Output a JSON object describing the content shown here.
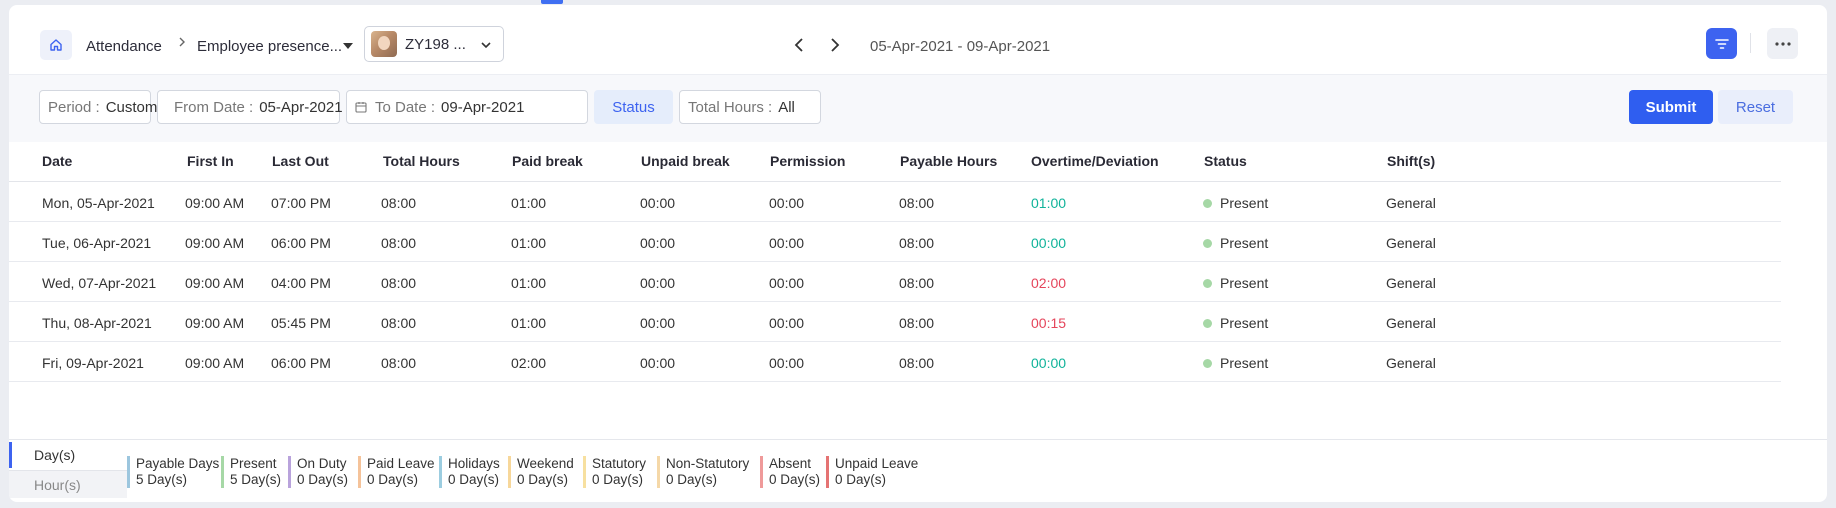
{
  "breadcrumb": {
    "module": "Attendance",
    "page": "Employee presence..."
  },
  "employee": {
    "code": "ZY198 ..."
  },
  "date_range": "05-Apr-2021 - 09-Apr-2021",
  "filters": {
    "period_label": "Period :",
    "period_value": "Custom",
    "from_label": "From Date :",
    "from_value": "05-Apr-2021",
    "to_label": "To Date :",
    "to_value": "09-Apr-2021",
    "status_label": "Status",
    "total_hours_label": "Total Hours :",
    "total_hours_value": "All",
    "submit_label": "Submit",
    "reset_label": "Reset"
  },
  "table": {
    "headers": [
      "Date",
      "First In",
      "Last Out",
      "Total Hours",
      "Paid break",
      "Unpaid break",
      "Permission",
      "Payable Hours",
      "Overtime/Deviation",
      "Status",
      "Shift(s)"
    ],
    "rows": [
      {
        "date": "Mon, 05-Apr-2021",
        "first_in": "09:00 AM",
        "last_out": "07:00 PM",
        "total": "08:00",
        "paid": "01:00",
        "unpaid": "00:00",
        "permission": "00:00",
        "payable": "08:00",
        "overtime": "01:00",
        "overtime_color": "#10b39a",
        "status": "Present",
        "shift": "General"
      },
      {
        "date": "Tue, 06-Apr-2021",
        "first_in": "09:00 AM",
        "last_out": "06:00 PM",
        "total": "08:00",
        "paid": "01:00",
        "unpaid": "00:00",
        "permission": "00:00",
        "payable": "08:00",
        "overtime": "00:00",
        "overtime_color": "#10b39a",
        "status": "Present",
        "shift": "General"
      },
      {
        "date": "Wed, 07-Apr-2021",
        "first_in": "09:00 AM",
        "last_out": "04:00 PM",
        "total": "08:00",
        "paid": "01:00",
        "unpaid": "00:00",
        "permission": "00:00",
        "payable": "08:00",
        "overtime": "02:00",
        "overtime_color": "#e5455b",
        "status": "Present",
        "shift": "General"
      },
      {
        "date": "Thu, 08-Apr-2021",
        "first_in": "09:00 AM",
        "last_out": "05:45 PM",
        "total": "08:00",
        "paid": "01:00",
        "unpaid": "00:00",
        "permission": "00:00",
        "payable": "08:00",
        "overtime": "00:15",
        "overtime_color": "#e5455b",
        "status": "Present",
        "shift": "General"
      },
      {
        "date": "Fri, 09-Apr-2021",
        "first_in": "09:00 AM",
        "last_out": "06:00 PM",
        "total": "08:00",
        "paid": "02:00",
        "unpaid": "00:00",
        "permission": "00:00",
        "payable": "08:00",
        "overtime": "00:00",
        "overtime_color": "#10b39a",
        "status": "Present",
        "shift": "General"
      }
    ]
  },
  "footer": {
    "tabs": [
      "Day(s)",
      "Hour(s)"
    ],
    "legend": [
      {
        "label": "Payable Days",
        "value": "5 Day(s)",
        "color": "#9cc6de"
      },
      {
        "label": "Present",
        "value": "5 Day(s)",
        "color": "#a6d8a6"
      },
      {
        "label": "On Duty",
        "value": "0 Day(s)",
        "color": "#b9a3dc"
      },
      {
        "label": "Paid Leave",
        "value": "0 Day(s)",
        "color": "#f5c39a"
      },
      {
        "label": "Holidays",
        "value": "0 Day(s)",
        "color": "#9ccde0"
      },
      {
        "label": "Weekend",
        "value": "0 Day(s)",
        "color": "#f7d79a"
      },
      {
        "label": "Statutory",
        "value": "0 Day(s)",
        "color": "#f7e0a0"
      },
      {
        "label": "Non-Statutory",
        "value": "0 Day(s)",
        "color": "#f5d8a8"
      },
      {
        "label": "Absent",
        "value": "0 Day(s)",
        "color": "#ef9a9a"
      },
      {
        "label": "Unpaid Leave",
        "value": "0 Day(s)",
        "color": "#e57373"
      }
    ]
  },
  "colors": {
    "accent": "#3d63f0",
    "present_dot": "#a6d8a6"
  }
}
